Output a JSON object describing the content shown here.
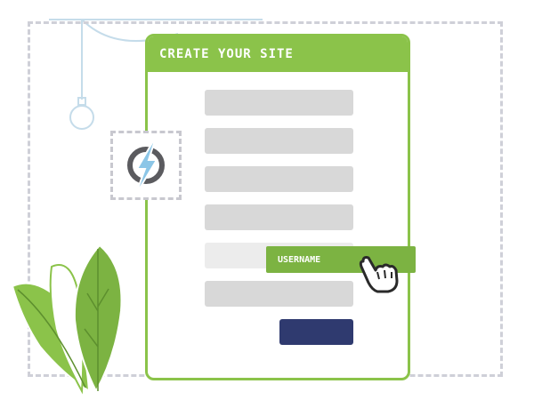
{
  "form": {
    "title": "CREATE YOUR SITE",
    "field_count": 6,
    "highlighted_field_label": "USERNAME"
  },
  "icons": {
    "logo": "lightning-bolt-logo-icon",
    "cursor": "pointing-hand-cursor-icon",
    "bulb": "light-bulb-icon",
    "plant": "leaf-plant-icon"
  },
  "colors": {
    "accent_green": "#8bc34a",
    "tag_green": "#7cb342",
    "field_gray": "#d8d8d8",
    "submit_navy": "#2f3a6f",
    "dash_gray": "#cfd0d8",
    "line_blue": "#c5dcea"
  }
}
